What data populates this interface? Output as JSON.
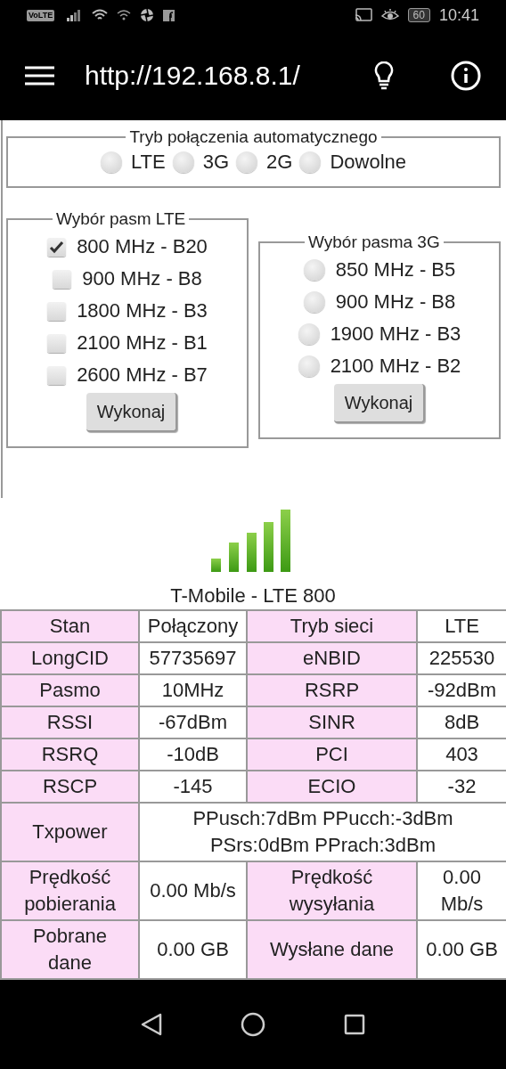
{
  "status_bar": {
    "badge": "VoLTE",
    "battery": "60",
    "time": "10:41"
  },
  "app_bar": {
    "title": "http://192.168.8.1/"
  },
  "connection_mode": {
    "legend": "Tryb połączenia automatycznego",
    "options": [
      {
        "label": "LTE",
        "selected": false
      },
      {
        "label": "3G",
        "selected": false
      },
      {
        "label": "2G",
        "selected": false
      },
      {
        "label": "Dowolne",
        "selected": false
      }
    ]
  },
  "lte_bands": {
    "legend": "Wybór pasm LTE",
    "items": [
      {
        "label": "800 MHz - B20",
        "checked": true
      },
      {
        "label": "900 MHz - B8",
        "checked": false
      },
      {
        "label": "1800 MHz - B3",
        "checked": false
      },
      {
        "label": "2100 MHz - B1",
        "checked": false
      },
      {
        "label": "2600 MHz - B7",
        "checked": false
      }
    ],
    "button": "Wykonaj"
  },
  "bands_3g": {
    "legend": "Wybór pasma 3G",
    "options": [
      {
        "label": "850 MHz - B5",
        "selected": false
      },
      {
        "label": "900 MHz - B8",
        "selected": false
      },
      {
        "label": "1900 MHz - B3",
        "selected": false
      },
      {
        "label": "2100 MHz - B2",
        "selected": false
      }
    ],
    "button": "Wykonaj"
  },
  "network_title": "T-Mobile - LTE 800",
  "table": {
    "rows": [
      {
        "cells": [
          {
            "text": "Stan",
            "kind": "label"
          },
          {
            "text": "Połączony",
            "kind": "value"
          },
          {
            "text": "Tryb sieci",
            "kind": "label"
          },
          {
            "text": "LTE",
            "kind": "value"
          }
        ]
      },
      {
        "cells": [
          {
            "text": "LongCID",
            "kind": "label"
          },
          {
            "text": "57735697",
            "kind": "value"
          },
          {
            "text": "eNBID",
            "kind": "label"
          },
          {
            "text": "225530",
            "kind": "value"
          }
        ]
      },
      {
        "cells": [
          {
            "text": "Pasmo",
            "kind": "label"
          },
          {
            "text": "10MHz",
            "kind": "value"
          },
          {
            "text": "RSRP",
            "kind": "label"
          },
          {
            "text": "-92dBm",
            "kind": "value"
          }
        ]
      },
      {
        "cells": [
          {
            "text": "RSSI",
            "kind": "label"
          },
          {
            "text": "-67dBm",
            "kind": "value"
          },
          {
            "text": "SINR",
            "kind": "label"
          },
          {
            "text": "8dB",
            "kind": "value"
          }
        ]
      },
      {
        "cells": [
          {
            "text": "RSRQ",
            "kind": "label"
          },
          {
            "text": "-10dB",
            "kind": "value"
          },
          {
            "text": "PCI",
            "kind": "label"
          },
          {
            "text": "403",
            "kind": "value"
          }
        ]
      },
      {
        "cells": [
          {
            "text": "RSCP",
            "kind": "label"
          },
          {
            "text": "-145",
            "kind": "value"
          },
          {
            "text": "ECIO",
            "kind": "label"
          },
          {
            "text": "-32",
            "kind": "value"
          }
        ]
      },
      {
        "cells": [
          {
            "text": "Txpower",
            "kind": "label"
          },
          {
            "text": "PPusch:7dBm PPucch:-3dBm PSrs:0dBm PPrach:3dBm",
            "kind": "wide",
            "colspan": 3
          }
        ]
      },
      {
        "cells": [
          {
            "text": "Prędkość pobierania",
            "kind": "label"
          },
          {
            "text": "0.00 Mb/s",
            "kind": "value"
          },
          {
            "text": "Prędkość wysyłania",
            "kind": "label"
          },
          {
            "text": "0.00 Mb/s",
            "kind": "value"
          }
        ]
      },
      {
        "cells": [
          {
            "text": "Pobrane dane",
            "kind": "label"
          },
          {
            "text": "0.00 GB",
            "kind": "value"
          },
          {
            "text": "Wysłane dane",
            "kind": "label"
          },
          {
            "text": "0.00 GB",
            "kind": "value"
          }
        ]
      }
    ]
  }
}
